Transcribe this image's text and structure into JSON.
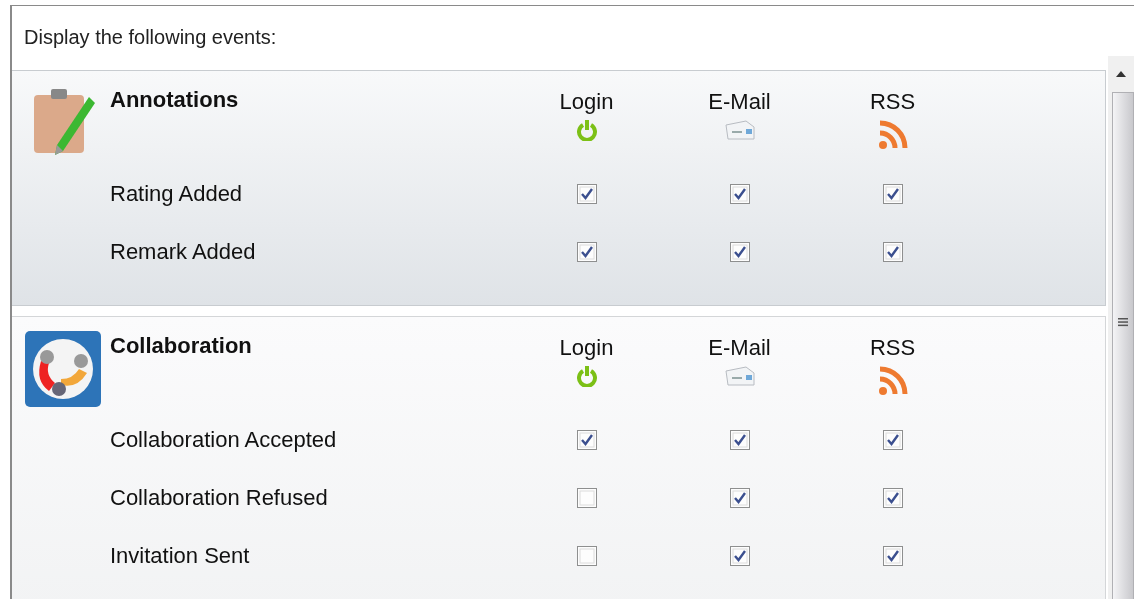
{
  "heading": "Display the following events:",
  "sections": [
    {
      "title": "Annotations",
      "kind": "clipboard",
      "highlighted": true,
      "columns": [
        {
          "label": "Login",
          "kind": "power"
        },
        {
          "label": "E-Mail",
          "kind": "mail"
        },
        {
          "label": "RSS",
          "kind": "rss"
        }
      ],
      "rows": [
        {
          "label": "Rating Added",
          "checks": [
            {
              "checked": true
            },
            {
              "checked": true
            },
            {
              "checked": true
            }
          ]
        },
        {
          "label": "Remark Added",
          "checks": [
            {
              "checked": true
            },
            {
              "checked": true
            },
            {
              "checked": true
            }
          ]
        }
      ]
    },
    {
      "title": "Collaboration",
      "kind": "people",
      "highlighted": false,
      "columns": [
        {
          "label": "Login",
          "kind": "power"
        },
        {
          "label": "E-Mail",
          "kind": "mail"
        },
        {
          "label": "RSS",
          "kind": "rss"
        }
      ],
      "rows": [
        {
          "label": "Collaboration Accepted",
          "checks": [
            {
              "checked": true
            },
            {
              "checked": true
            },
            {
              "checked": true
            }
          ]
        },
        {
          "label": "Collaboration Refused",
          "checks": [
            {
              "checked": false
            },
            {
              "checked": true
            },
            {
              "checked": true
            }
          ]
        },
        {
          "label": "Invitation Sent",
          "checks": [
            {
              "checked": false
            },
            {
              "checked": true
            },
            {
              "checked": true
            }
          ]
        }
      ]
    }
  ]
}
